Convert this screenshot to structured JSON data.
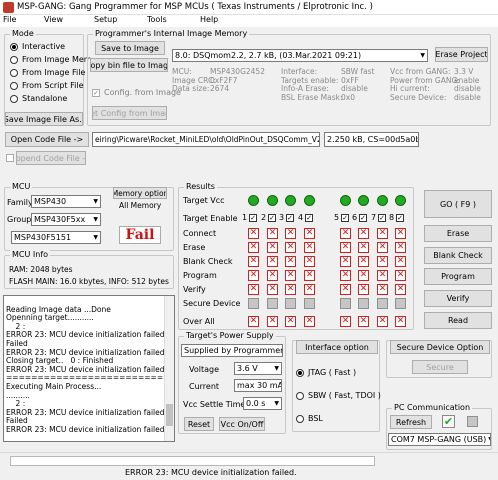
{
  "window": {
    "title": "MSP-GANG:  Gang Programmer for MSP MCUs  ( Texas Instruments / Elprotronic Inc. )"
  },
  "menu": [
    "File",
    "View",
    "Setup",
    "Tools",
    "Help"
  ],
  "mode": {
    "title": "Mode",
    "options": [
      "Interactive",
      "From Image Mem.",
      "From Image File",
      "From Script File",
      "Standalone"
    ],
    "selected": 0,
    "save_btn": "Save Image File As.."
  },
  "image_mem": {
    "title": "Programmer's Internal Image Memory",
    "save_btn": "Save to Image",
    "copy_btn": "Copy bin file to Image",
    "config_chk": "Config. from Image",
    "get_config_btn": "Get Config from Image",
    "select_value": "8.0: DSQmom2.2,   2.7 kB,  (03.Mar.2021  09:21)",
    "erase_btn": "Erase Project",
    "info": [
      {
        "k": "MCU:",
        "v": "MSP430G2452"
      },
      {
        "k": "Image CRC:",
        "v": "0xF2F7"
      },
      {
        "k": "Data size:",
        "v": "2674"
      },
      {
        "k": "Interface:",
        "v": "SBW fast"
      },
      {
        "k": "Targets enable:",
        "v": "0xFF"
      },
      {
        "k": "Info-A Erase:",
        "v": "disable"
      },
      {
        "k": "BSL Erase Mask:",
        "v": "0x0"
      },
      {
        "k": "Vcc from GANG:",
        "v": "3.3 V"
      },
      {
        "k": "Power from GANG:",
        "v": "enable"
      },
      {
        "k": "Hi current:",
        "v": "disable"
      },
      {
        "k": "Secure Device:",
        "v": "disable"
      }
    ]
  },
  "code_file": {
    "open_btn": "Open Code File ->",
    "path": "eiring\\Picware\\Rocket_MiniLED\\old\\OldPinOut_DSQComm_V2_2.hex",
    "info": "2.250 kB, CS=00d5a0b7",
    "append_btn": "Append Code File ->"
  },
  "mcu": {
    "title": "MCU",
    "family_label": "Family:",
    "family": "MSP430",
    "group_label": "Group:",
    "group": "MSP430F5xx",
    "device": "MSP430F5151",
    "mem_opt_btn": "Memory option",
    "mem_opt_value": "All Memory",
    "status": "Fail"
  },
  "mcu_info": {
    "title": "MCU Info",
    "ram": "RAM:  2048 bytes",
    "flash": "FLASH MAIN:  16.0 kbytes,  INFO: 512 bytes"
  },
  "results": {
    "title": "Results",
    "rows": [
      "Target Vcc",
      "Target Enable",
      "Connect",
      "Erase",
      "Blank Check",
      "Program",
      "Verify",
      "Secure Device",
      "Over All"
    ],
    "targets": [
      "1",
      "2",
      "3",
      "4",
      "5",
      "6",
      "7",
      "8"
    ]
  },
  "actions": {
    "go": "GO    ( F9 )",
    "erase": "Erase",
    "blank": "Blank Check",
    "program": "Program",
    "verify": "Verify",
    "read": "Read"
  },
  "log": {
    "lines": [
      "Reading Image data ...Done",
      "Openning target...........",
      "    2 :",
      "ERROR 23: MCU device initialization failed.",
      "Failed",
      "ERROR 23: MCU device initialization failed.",
      "Closing target..   0 : Finished",
      "ERROR 23: MCU device initialization failed.",
      "=============================",
      "Executing Main Process...",
      "..........",
      "    2 :",
      "ERROR 23: MCU device initialization failed.",
      "Failed",
      "ERROR 23: MCU device initialization failed."
    ]
  },
  "power": {
    "title": "Target's Power Supply",
    "source": "Supplied by Programmer",
    "voltage_label": "Voltage",
    "voltage": "3.6 V",
    "current_label": "Current",
    "current": "max 30 mA",
    "settle_label": "Vcc Settle Time",
    "settle": "0.0 s",
    "reset_btn": "Reset",
    "vcc_btn": "Vcc On/Off"
  },
  "interface": {
    "btn": "Interface option",
    "options": [
      "JTAG ( Fast )",
      "SBW ( Fast, TDOI )",
      "BSL"
    ],
    "selected": 0
  },
  "secure": {
    "btn": "Secure Device Option",
    "secure_btn": "Secure"
  },
  "pc_comm": {
    "title": "PC Communication",
    "refresh_btn": "Refresh",
    "check": "✔",
    "port": "COM7  MSP-GANG (USB)"
  },
  "status_bar": "ERROR 23: MCU device initialization failed.",
  "colors": {
    "ok": "#22aa22",
    "fail": "#cc2222",
    "fail_text": "#d01010"
  }
}
